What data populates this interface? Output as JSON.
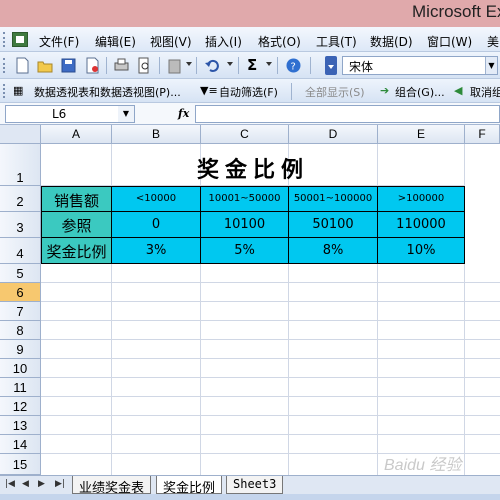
{
  "app_title": "Microsoft Ex",
  "menu": [
    "文件(F)",
    "编辑(E)",
    "视图(V)",
    "插入(I)",
    "格式(O)",
    "工具(T)",
    "数据(D)",
    "窗口(W)",
    "美"
  ],
  "toolbar": {
    "sigma": "Σ",
    "font_name": "宋体"
  },
  "pivot_toolbar": {
    "pivot_label": "数据透视表和数据透视图(P)...",
    "autofilter_label": "自动筛选(F)",
    "show_all_label": "全部显示(S)",
    "group_label": "组合(G)...",
    "ungroup_label": "取消组"
  },
  "formula_bar": {
    "name_box": "L6",
    "fx": "fx",
    "formula": ""
  },
  "columns": [
    "A",
    "B",
    "C",
    "D",
    "E",
    "F"
  ],
  "rows": [
    "1",
    "2",
    "3",
    "4",
    "5",
    "6",
    "7",
    "8",
    "9",
    "10",
    "11",
    "12",
    "13",
    "14",
    "15"
  ],
  "selected_row": "6",
  "sheet": {
    "title": "奖金比例",
    "row_labels": [
      "销售额",
      "参照",
      "奖金比例"
    ],
    "sales_ranges": [
      "<10000",
      "10001~50000",
      "50001~100000",
      ">100000"
    ],
    "reference": [
      "0",
      "10100",
      "50100",
      "110000"
    ],
    "rates": [
      "3%",
      "5%",
      "8%",
      "10%"
    ]
  },
  "tabs": [
    "业绩奖金表",
    "奖金比例",
    "Sheet3"
  ],
  "active_tab": "奖金比例",
  "watermark": "Baidu 经验",
  "colors": {
    "header_cyan": "#00c8f0",
    "label_teal": "#3bc9c0",
    "selected_row": "#f7c86f",
    "title_bar": "#e0a9ab"
  }
}
